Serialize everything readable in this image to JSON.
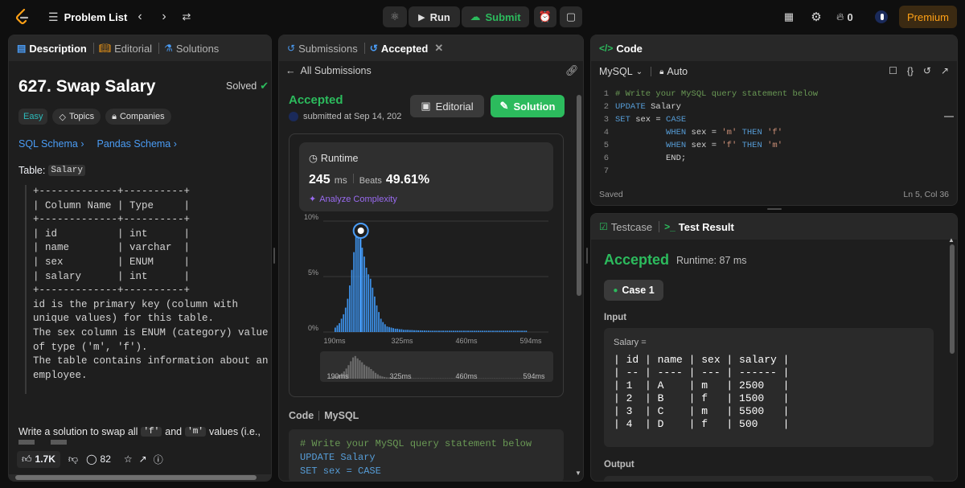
{
  "topbar": {
    "problem_list": "Problem List",
    "run": "Run",
    "submit": "Submit",
    "streak_count": "0",
    "premium": "Premium"
  },
  "left": {
    "tabs": {
      "description": "Description",
      "editorial": "Editorial",
      "solutions": "Solutions"
    },
    "title": "627. Swap Salary",
    "solved": "Solved",
    "difficulty": "Easy",
    "topics": "Topics",
    "companies": "Companies",
    "sql_schema": "SQL Schema",
    "pandas_schema": "Pandas Schema",
    "table_label": "Table:",
    "table_name": "Salary",
    "schema_lines": [
      "+-------------+----------+",
      "| Column Name | Type     |",
      "+-------------+----------+",
      "| id          | int      |",
      "| name        | varchar  |",
      "| sex         | ENUM     |",
      "| salary      | int      |",
      "+-------------+----------+",
      "id is the primary key (column with",
      "unique values) for this table.",
      "The sex column is ENUM (category) value",
      "of type ('m', 'f').",
      "The table contains information about an",
      "employee."
    ],
    "task_prefix": "Write a solution to swap all",
    "task_code_f": "'f'",
    "task_and": "and",
    "task_code_m": "'m'",
    "task_suffix": "values (i.e.,",
    "likes": "1.7K",
    "comments": "82"
  },
  "middle": {
    "tabs": {
      "submissions": "Submissions",
      "accepted": "Accepted"
    },
    "back": "All Submissions",
    "status": "Accepted",
    "submitted": "submitted at Sep 14, 202",
    "editorial_btn": "Editorial",
    "solution_btn": "Solution",
    "runtime_label": "Runtime",
    "runtime_value": "245",
    "runtime_unit": "ms",
    "beats_label": "Beats",
    "beats_value": "49.61%",
    "analyze": "Analyze Complexity",
    "code_label": "Code",
    "code_lang": "MySQL",
    "code_lines": [
      "# Write your MySQL query statement below",
      "UPDATE Salary",
      "SET sex = CASE"
    ]
  },
  "chart_data": {
    "type": "bar",
    "title": "",
    "xlabel": "",
    "ylabel": "",
    "ytick_labels": [
      "10%",
      "5%",
      "0%"
    ],
    "xtick_labels": [
      "190ms",
      "325ms",
      "460ms",
      "594ms"
    ],
    "ylim": [
      0,
      10
    ],
    "xlim": [
      190,
      594
    ],
    "highlight_x": 245,
    "values": [
      0.4,
      0.6,
      0.8,
      1.2,
      1.6,
      2.2,
      3.0,
      4.2,
      5.6,
      7.2,
      8.8,
      9.4,
      8.4,
      7.6,
      6.8,
      5.8,
      5.2,
      4.8,
      4.0,
      3.2,
      2.4,
      1.8,
      1.2,
      0.9,
      0.7,
      0.5,
      0.45,
      0.4,
      0.35,
      0.3,
      0.3,
      0.25,
      0.25,
      0.2,
      0.2,
      0.2,
      0.18,
      0.18,
      0.16,
      0.16,
      0.15,
      0.15,
      0.14,
      0.14,
      0.13,
      0.13,
      0.12,
      0.12,
      0.12,
      0.12,
      0.12,
      0.12,
      0.12,
      0.12,
      0.12,
      0.12,
      0.12,
      0.12,
      0.12,
      0.12,
      0.12,
      0.12,
      0.12,
      0.12,
      0.12,
      0.12,
      0.12,
      0.12,
      0.12,
      0.12,
      0.12,
      0.12,
      0.12,
      0.12,
      0.12,
      0.12,
      0.12,
      0.12,
      0.12,
      0.12,
      0.12,
      0.12,
      0.12,
      0.12,
      0.12,
      0.12,
      0.12,
      0.12,
      0.12,
      0.12,
      0.12,
      0.12,
      0.12
    ],
    "bar_color": "#3c8fe6",
    "grid": true
  },
  "right": {
    "code_tab": "Code",
    "lang": "MySQL",
    "auto": "Auto",
    "lines": [
      {
        "n": "1",
        "parts": [
          [
            "cm",
            "# Write your MySQL query statement below"
          ]
        ]
      },
      {
        "n": "2",
        "parts": [
          [
            "kw",
            "UPDATE"
          ],
          [
            "sc",
            " Salary"
          ]
        ]
      },
      {
        "n": "3",
        "parts": [
          [
            "kw",
            "SET"
          ],
          [
            "sc",
            " sex = "
          ],
          [
            "kw",
            "CASE"
          ]
        ]
      },
      {
        "n": "4",
        "parts": [
          [
            "sc",
            "          "
          ],
          [
            "kw",
            "WHEN"
          ],
          [
            "sc",
            " sex = "
          ],
          [
            "str",
            "'m'"
          ],
          [
            "sc",
            " "
          ],
          [
            "kw",
            "THEN"
          ],
          [
            "sc",
            " "
          ],
          [
            "str",
            "'f'"
          ]
        ]
      },
      {
        "n": "5",
        "parts": [
          [
            "sc",
            "          "
          ],
          [
            "kw",
            "WHEN"
          ],
          [
            "sc",
            " sex = "
          ],
          [
            "str",
            "'f'"
          ],
          [
            "sc",
            " "
          ],
          [
            "kw",
            "THEN"
          ],
          [
            "sc",
            " "
          ],
          [
            "str",
            "'m'"
          ]
        ]
      },
      {
        "n": "6",
        "parts": [
          [
            "sc",
            "          END;"
          ]
        ]
      },
      {
        "n": "7",
        "parts": []
      }
    ],
    "saved": "Saved",
    "cursor": "Ln 5, Col 36",
    "testcase_tab": "Testcase",
    "result_tab": "Test Result",
    "result_status": "Accepted",
    "result_runtime": "Runtime: 87 ms",
    "case": "Case 1",
    "input_label": "Input",
    "input_var": "Salary =",
    "table_lines": [
      "| id | name | sex | salary |",
      "| -- | ---- | --- | ------ |",
      "| 1  | A    | m   | 2500   |",
      "| 2  | B    | f   | 1500   |",
      "| 3  | C    | m   | 5500   |",
      "| 4  | D    | f   | 500    |"
    ],
    "output_label": "Output"
  }
}
